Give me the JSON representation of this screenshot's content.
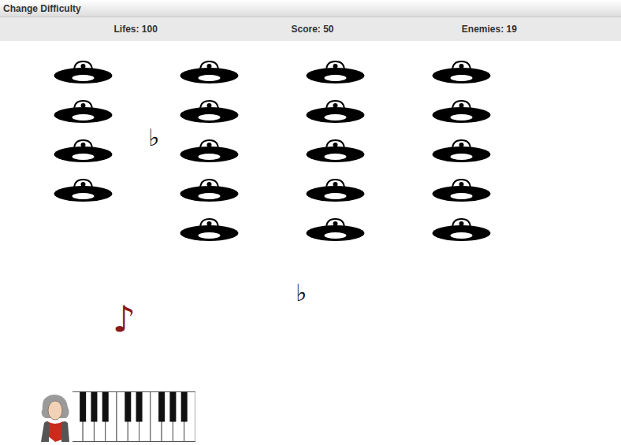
{
  "menu": {
    "label": "Change Difficulty"
  },
  "stats": [
    {
      "label": "Lifes: 100"
    },
    {
      "label": "Score: 50"
    },
    {
      "label": "Enemies: 19"
    }
  ],
  "enemies": {
    "columns": [
      [
        true,
        true,
        true,
        true,
        false
      ],
      [
        true,
        true,
        true,
        true,
        true
      ],
      [
        true,
        true,
        true,
        true,
        true
      ],
      [
        true,
        true,
        true,
        true,
        true
      ]
    ]
  },
  "projectiles": [
    {
      "glyph": "♭",
      "kind": "enemy-shot",
      "color": "#111111"
    },
    {
      "glyph": "♭",
      "kind": "enemy-shot",
      "color": "#111111"
    },
    {
      "glyph": "♪",
      "kind": "player-shot",
      "color": "#8b1a1a"
    }
  ]
}
